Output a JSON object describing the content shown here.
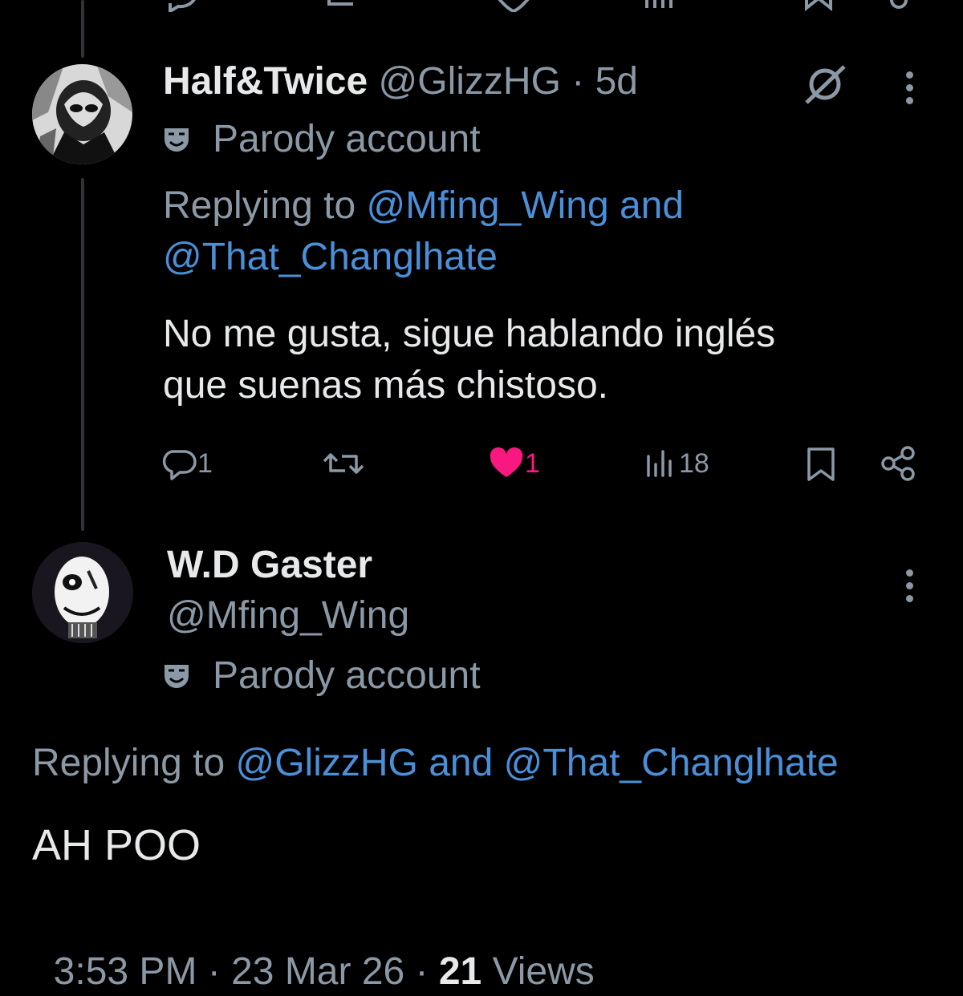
{
  "tweet1": {
    "display_name": "Half&Twice",
    "handle": "@GlizzHG",
    "separator": "·",
    "time": "5d",
    "parody_label": "Parody account",
    "replying_prefix": "Replying to",
    "replying_user1": "@Mfing_Wing",
    "replying_and": "and",
    "replying_user2": "@That_Changlhate",
    "body_line1": "No me gusta, sigue hablando inglés",
    "body_line2": "que suenas más chistoso.",
    "actions": {
      "reply_count": "1",
      "repost_count": "",
      "like_count": "1",
      "views_count": "18"
    }
  },
  "tweet2": {
    "display_name": "W.D Gaster",
    "handle": "@Mfing_Wing",
    "parody_label": "Parody account",
    "replying_prefix": "Replying to",
    "replying_user1": "@GlizzHG",
    "replying_and": "and",
    "replying_user2": "@That_Changlhate",
    "body": "AH POO",
    "timestamp": "3:53 PM · 23 Mar 26 · ",
    "views_number": "21",
    "views_label": " Views"
  },
  "colors": {
    "background": "#000000",
    "text": "#e7e9ea",
    "muted": "#8b98a5",
    "link": "#4a8fd8",
    "like": "#f91880"
  }
}
